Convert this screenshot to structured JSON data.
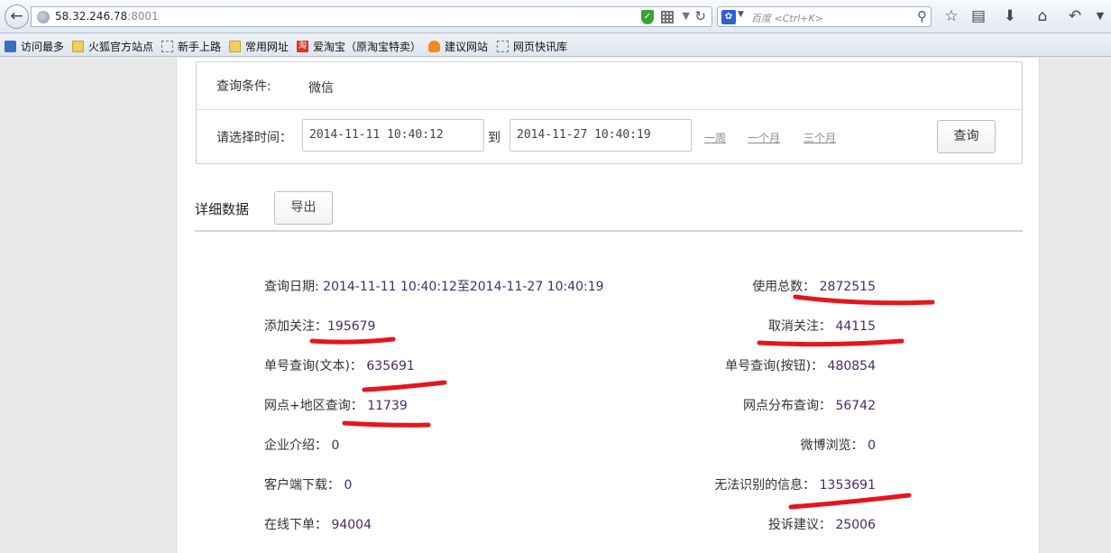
{
  "browser": {
    "url_host": "58.32.246.78",
    "url_port": ":8001",
    "search_placeholder": "百度 <Ctrl+K>",
    "bookmarks": [
      "访问最多",
      "火狐官方站点",
      "新手上路",
      "常用网址",
      "爱淘宝（原淘宝特卖）",
      "建议网站",
      "网页快讯库"
    ]
  },
  "filter": {
    "condition_label": "查询条件:",
    "condition_value": "微信",
    "time_label": "请选择时间：",
    "start_time": "2014-11-11 10:40:12",
    "to_label": "到",
    "end_time": "2014-11-27 10:40:19",
    "quick_ranges": [
      "一周",
      "一个月",
      "三个月"
    ],
    "query_label": "查询"
  },
  "details": {
    "title": "详细数据",
    "export_label": "导出",
    "date_label": "查询日期:",
    "date_value": "2014-11-11 10:40:12至2014-11-27 10:40:19",
    "left": [
      {
        "label": "添加关注：",
        "value": "195679"
      },
      {
        "label": "单号查询(文本)：",
        "value": "635691"
      },
      {
        "label": "网点+地区查询：",
        "value": "11739"
      },
      {
        "label": "企业介绍：",
        "value": "0"
      },
      {
        "label": "客户端下载：",
        "value": "0"
      },
      {
        "label": "在线下单：",
        "value": "94004"
      }
    ],
    "right": [
      {
        "label": "使用总数：",
        "value": "2872515"
      },
      {
        "label": "取消关注：",
        "value": "44115"
      },
      {
        "label": "单号查询(按钮)：",
        "value": "480854"
      },
      {
        "label": "网点分布查询：",
        "value": "56742"
      },
      {
        "label": "微博浏览：",
        "value": "0"
      },
      {
        "label": "无法识别的信息：",
        "value": "1353691"
      },
      {
        "label": "投诉建议：",
        "value": "25006"
      }
    ]
  },
  "colors": {
    "value_text": "#4a2a6a",
    "annotation_stroke": "#e8141c"
  }
}
